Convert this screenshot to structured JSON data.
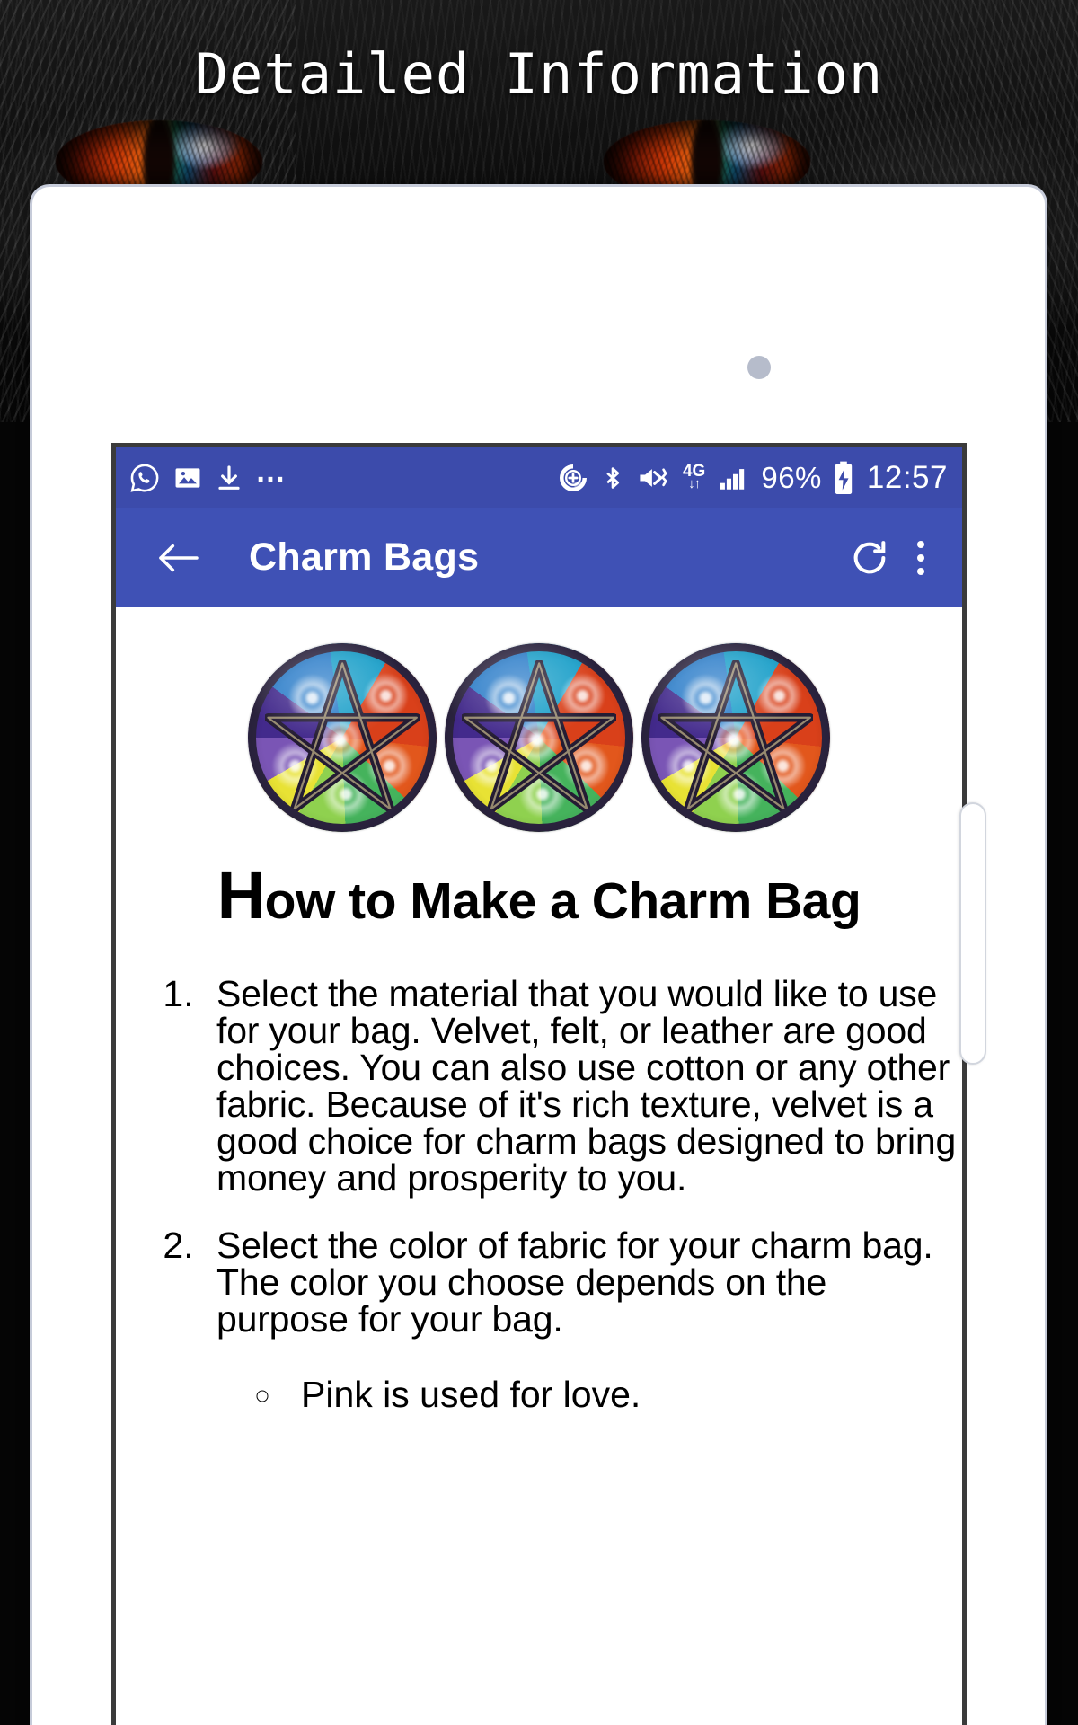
{
  "header": {
    "title": "Detailed Information"
  },
  "card": {
    "dot_icon": "circle-dot"
  },
  "phone": {
    "statusbar": {
      "left_icons": [
        {
          "name": "whatsapp-icon",
          "glyph": "whatsapp"
        },
        {
          "name": "image-icon",
          "glyph": "picture"
        },
        {
          "name": "download-icon",
          "glyph": "download"
        },
        {
          "name": "more-notifications-icon",
          "glyph": "..."
        }
      ],
      "right_icons": [
        {
          "name": "add-account-icon",
          "glyph": "circle-plus"
        },
        {
          "name": "bluetooth-icon",
          "glyph": "bluetooth"
        },
        {
          "name": "mute-vibrate-icon",
          "glyph": "speaker-mute"
        },
        {
          "name": "network-4g-icon",
          "glyph": "4G"
        },
        {
          "name": "signal-bars-icon",
          "glyph": "signal"
        }
      ],
      "network_label_top": "4G",
      "network_label_bottom": "↓↑",
      "battery_percent": "96%",
      "battery_icon": "battery-charging-icon",
      "time": "12:57"
    },
    "appbar": {
      "back_label": "back-arrow",
      "title": "Charm Bags",
      "refresh_label": "refresh",
      "overflow_label": "more-options",
      "background_color": "#3f51b5"
    },
    "content": {
      "images": [
        {
          "name": "pentacle-image-1",
          "alt": "elemental pentacle"
        },
        {
          "name": "pentacle-image-2",
          "alt": "elemental pentacle"
        },
        {
          "name": "pentacle-image-3",
          "alt": "elemental pentacle"
        }
      ],
      "heading_dropcap": "H",
      "heading_rest": "ow to Make a Charm Bag",
      "steps": [
        "Select the material that you would like to use for your bag. Velvet, felt, or leather are good choices. You can also use cotton or any other fabric. Because of it's rich texture, velvet is a good choice for charm bags designed to bring money and prosperity to you.",
        "Select the color of fabric for your charm bag. The color you choose depends on the purpose for your bag."
      ],
      "sub_items": [
        "Pink is used for love."
      ]
    }
  },
  "colors": {
    "status_bar": "#3c4bab",
    "app_bar": "#3f51b5",
    "card_border": "#c6cbd9",
    "page_background": "#050505",
    "text": "#000000"
  }
}
